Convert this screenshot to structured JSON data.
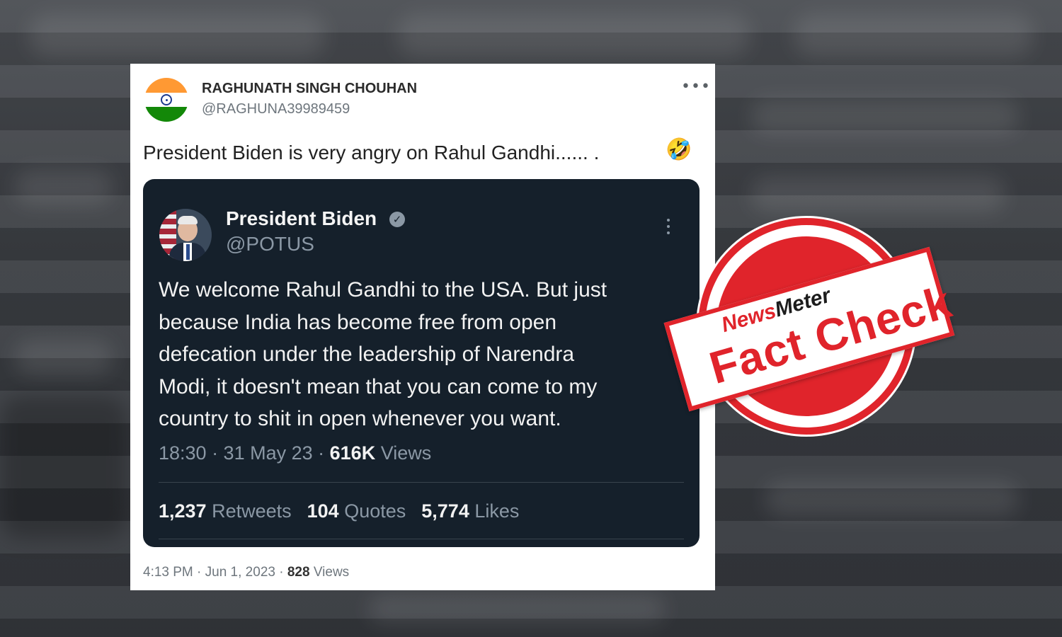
{
  "tweet": {
    "user_name": "RAGHUNATH SINGH CHOUHAN",
    "user_handle": "@RAGHUNA39989459",
    "more_icon": "more-horizontal-icon",
    "text": "President Biden is very angry on Rahul Gandhi...... .",
    "emoji": "🤣",
    "timestamp": "4:13 PM · Jun 1, 2023 · ",
    "views_count": "828",
    "views_label": " Views"
  },
  "quoted_tweet": {
    "name": "President Biden",
    "handle": "@POTUS",
    "verified_icon": "verified-badge-icon",
    "body_lines": [
      "We welcome Rahul Gandhi to the USA. But just",
      "because India has become free from open",
      "defecation under the leadership of Narendra",
      "Modi, it doesn't mean that you can come to my",
      "country to shit in open whenever you want."
    ],
    "time_date": "18:30 · 31 May 23 · ",
    "views_count": "616K",
    "views_label": " Views",
    "retweets_count": "1,237",
    "retweets_label": " Retweets",
    "quotes_count": "104",
    "quotes_label": " Quotes",
    "likes_count": "5,774",
    "likes_label": " Likes"
  },
  "stamp": {
    "brand_part1": "News",
    "brand_part2": "Meter",
    "title": "Fact Check",
    "color": "#e0242b"
  }
}
